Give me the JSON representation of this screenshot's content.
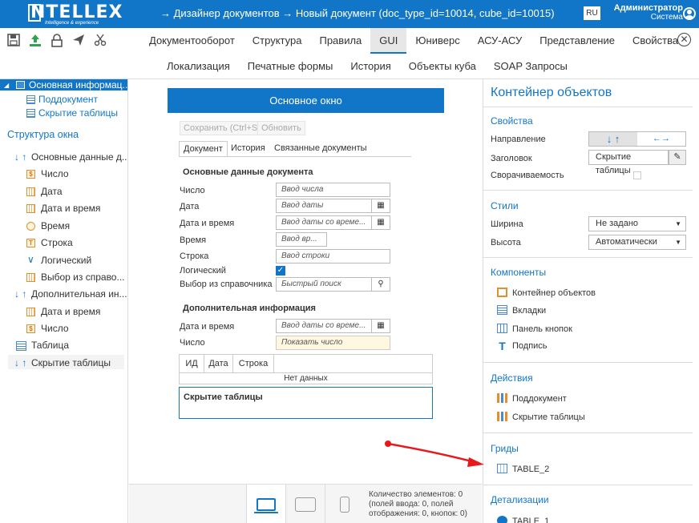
{
  "header": {
    "logo_text": "NTELLEX",
    "logo_sub": "Intelligence & experience",
    "breadcrumb": "→  Дизайнер документов  →  Новый документ (doc_type_id=10014, cube_id=10015)",
    "lang": "RU",
    "user_name": "Администратор",
    "user_role": "Система"
  },
  "toolbar": {
    "icons": [
      "save-icon",
      "upload-icon",
      "lock-icon",
      "send-icon",
      "cut-icon"
    ],
    "tabs_row1": [
      "Документооборот",
      "Структура",
      "Правила",
      "GUI",
      "Юниверс",
      "АСУ-АСУ",
      "Представление",
      "Свойства"
    ],
    "active_tab": "GUI",
    "tabs_row2": [
      "Локализация",
      "Печатные формы",
      "История",
      "Объекты куба",
      "SOAP Запросы"
    ]
  },
  "sidebar": {
    "tree_top": "Основная информац...",
    "sub_links": [
      "Поддокумент",
      "Скрытие таблицы"
    ],
    "structure_title": "Структура окна",
    "group1": "Основные данные д...",
    "group1_items": [
      "Число",
      "Дата",
      "Дата и время",
      "Время",
      "Строка",
      "Логический",
      "Выбор из справо..."
    ],
    "group2": "Дополнительная ин...",
    "group2_items": [
      "Дата и время",
      "Число"
    ],
    "table": "Таблица",
    "hide_table": "Скрытие таблицы",
    "glyph_s": "$",
    "glyph_t": "T",
    "glyph_check": "∨",
    "glyph_arrows": "↓ ↑"
  },
  "form": {
    "title": "Основное окно",
    "save_btn": "Сохранить (Ctrl+S)",
    "refresh_btn": "Обновить",
    "tabs": [
      "Документ",
      "История",
      "Связанные документы"
    ],
    "section1": "Основные данные документа",
    "labels1": [
      "Число",
      "Дата",
      "Дата и время",
      "Время",
      "Строка",
      "Логический",
      "Выбор из справочника"
    ],
    "placeholders1": [
      "Ввод числа",
      "Ввод даты",
      "Ввод даты со време...",
      "Ввод вр...",
      "Ввод строки",
      "Быстрый поиск"
    ],
    "section2": "Дополнительная информация",
    "labels2": [
      "Дата и время",
      "Число"
    ],
    "placeholder_dt2": "Ввод даты со време...",
    "show_number": "Показать число",
    "grid_cols": [
      "ИД",
      "Дата",
      "Строка"
    ],
    "grid_empty": "Нет данных",
    "hidden_table": "Скрытие таблицы",
    "checkbox_checked": true,
    "glyph_check": "✓",
    "glyph_search": "⚲",
    "glyph_calendar": "▦"
  },
  "status": {
    "count_line1": "Количество элементов: 0",
    "count_line2": "(полей ввода: 0, полей",
    "count_line3": "отображения: 0, кнопок: 0)"
  },
  "rpanel": {
    "title": "Контейнер объектов",
    "props_section": "Свойства",
    "direction_label": "Направление",
    "dir_vertical": "↓ ↑",
    "dir_horizontal": "←→",
    "caption_label": "Заголовок",
    "caption_value": "Скрытие таблицы",
    "collapse_label": "Сворачиваемость",
    "styles_section": "Стили",
    "width_label": "Ширина",
    "width_value": "Не задано",
    "height_label": "Высота",
    "height_value": "Автоматически",
    "components_section": "Компоненты",
    "components": [
      "Контейнер объектов",
      "Вкладки",
      "Панель кнопок",
      "Подпись"
    ],
    "actions_section": "Действия",
    "actions": [
      "Поддокумент",
      "Скрытие таблицы"
    ],
    "grids_section": "Гриды",
    "grids": [
      "TABLE_2"
    ],
    "details_section": "Детализации",
    "details": [
      "TABLE_1"
    ],
    "glyph_pen": "✎",
    "glyph_caret": "▼",
    "glyph_text": "T"
  },
  "colors": {
    "accent": "#1276c8",
    "annotation": "#e8191b"
  }
}
